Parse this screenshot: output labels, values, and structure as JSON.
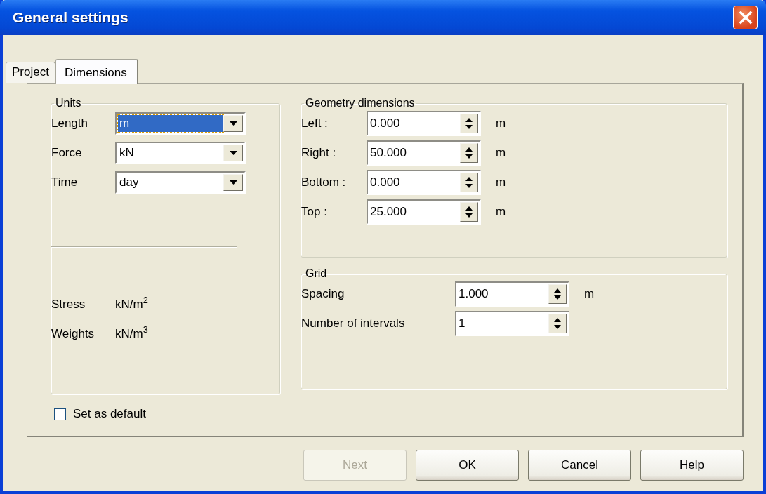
{
  "window": {
    "title": "General settings"
  },
  "tabs": [
    {
      "label": "Project",
      "selected": false
    },
    {
      "label": "Dimensions",
      "selected": true
    }
  ],
  "units": {
    "title": "Units",
    "fields": [
      {
        "label": "Length",
        "value": "m",
        "focused": true
      },
      {
        "label": "Force",
        "value": "kN",
        "focused": false
      },
      {
        "label": "Time",
        "value": "day",
        "focused": false
      }
    ],
    "derived": [
      {
        "label": "Stress",
        "value": "kN/m$^{2}$"
      },
      {
        "label": "Weights",
        "value": "kN/m$^{3}$"
      }
    ]
  },
  "geometry": {
    "title": "Geometry dimensions",
    "fields": [
      {
        "label": "Left :",
        "value": "0.000",
        "unit": "m"
      },
      {
        "label": "Right :",
        "value": "50.000",
        "unit": "m"
      },
      {
        "label": "Bottom :",
        "value": "0.000",
        "unit": "m"
      },
      {
        "label": "Top :",
        "value": "25.000",
        "unit": "m"
      }
    ]
  },
  "grid": {
    "title": "Grid",
    "fields": [
      {
        "label": "Spacing",
        "value": "1.000",
        "unit": "m"
      },
      {
        "label": "Number of intervals",
        "value": "1"
      }
    ]
  },
  "set_as_default": {
    "label": "Set as default",
    "checked": false
  },
  "buttons": [
    {
      "label": "Next",
      "disabled": true
    },
    {
      "label": "OK",
      "disabled": false
    },
    {
      "label": "Cancel",
      "disabled": false
    },
    {
      "label": "Help",
      "disabled": false
    }
  ]
}
